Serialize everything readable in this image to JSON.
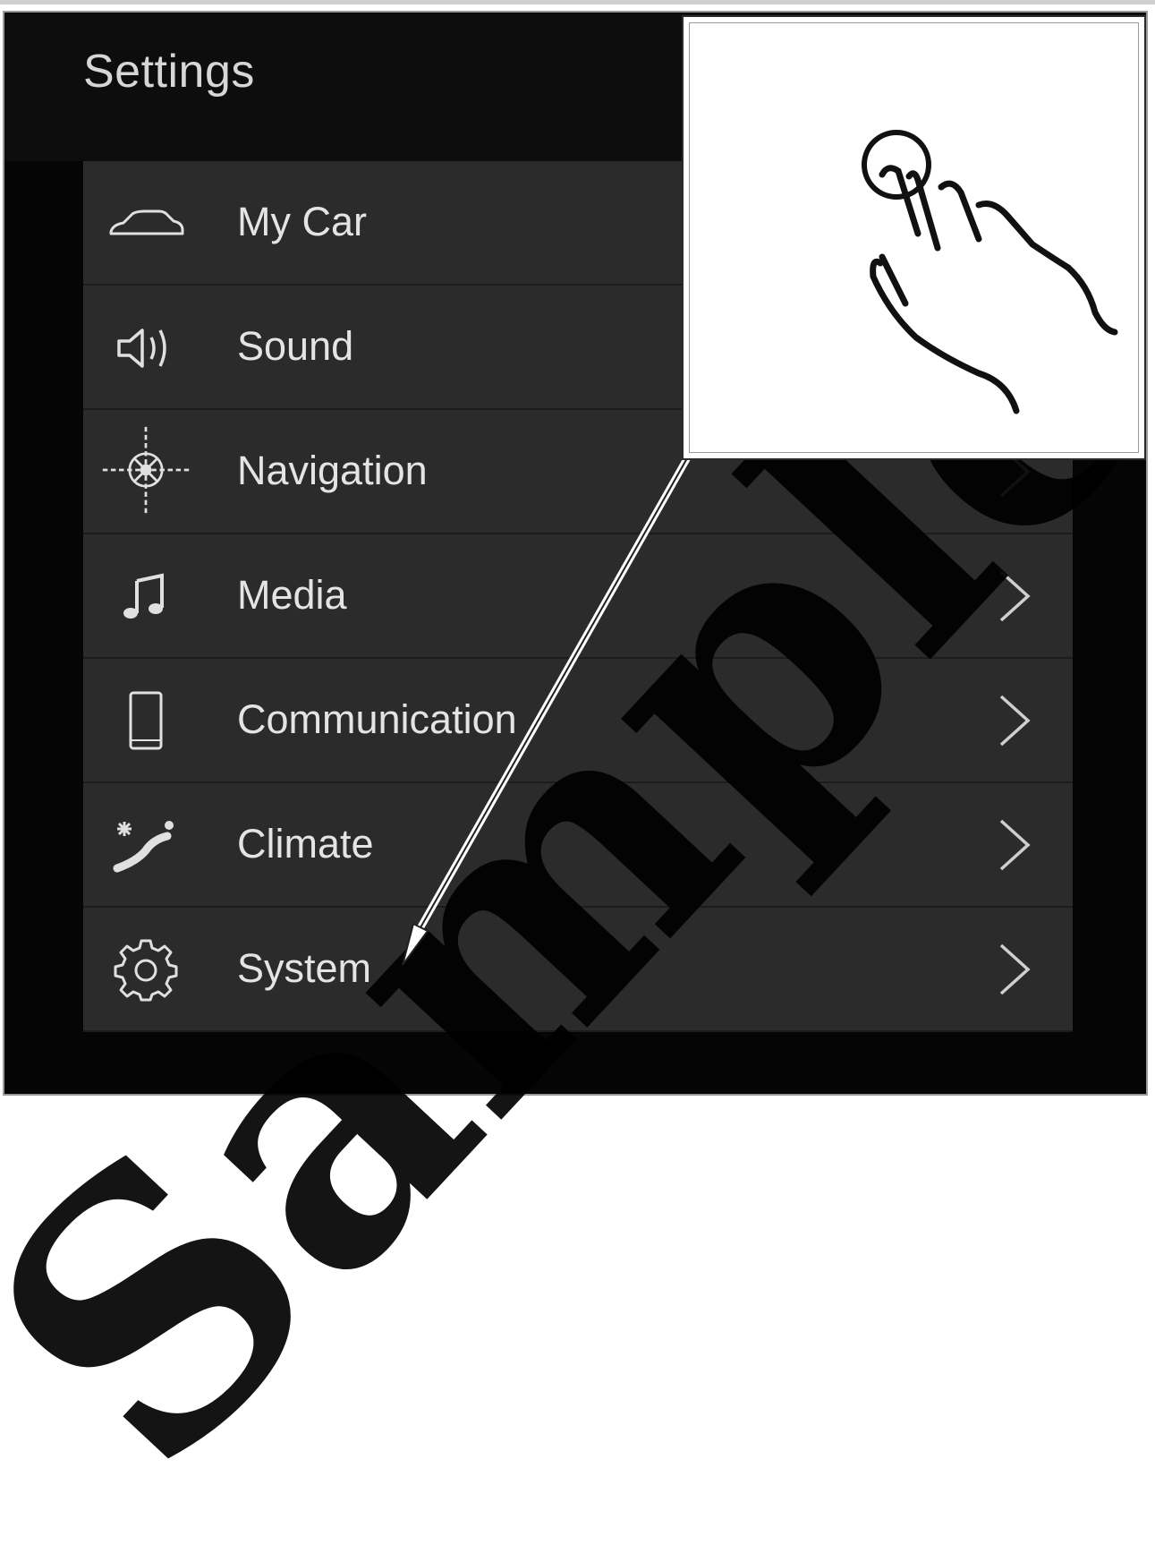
{
  "screen": {
    "title": "Settings"
  },
  "menu": {
    "items": [
      {
        "label": "My Car",
        "icon": "car-icon"
      },
      {
        "label": "Sound",
        "icon": "speaker-icon"
      },
      {
        "label": "Navigation",
        "icon": "compass-icon"
      },
      {
        "label": "Media",
        "icon": "music-note-icon"
      },
      {
        "label": "Communication",
        "icon": "phone-icon"
      },
      {
        "label": "Climate",
        "icon": "climate-icon"
      },
      {
        "label": "System",
        "icon": "gear-icon"
      }
    ],
    "chevron_icon": "chevron-right-icon"
  },
  "callout": {
    "icon": "hand-tap-icon"
  },
  "watermark": {
    "text": "Sample"
  },
  "colors": {
    "panel_background": "#050505",
    "menu_row": "#2b2b2b",
    "text": "#e4e4e4"
  }
}
